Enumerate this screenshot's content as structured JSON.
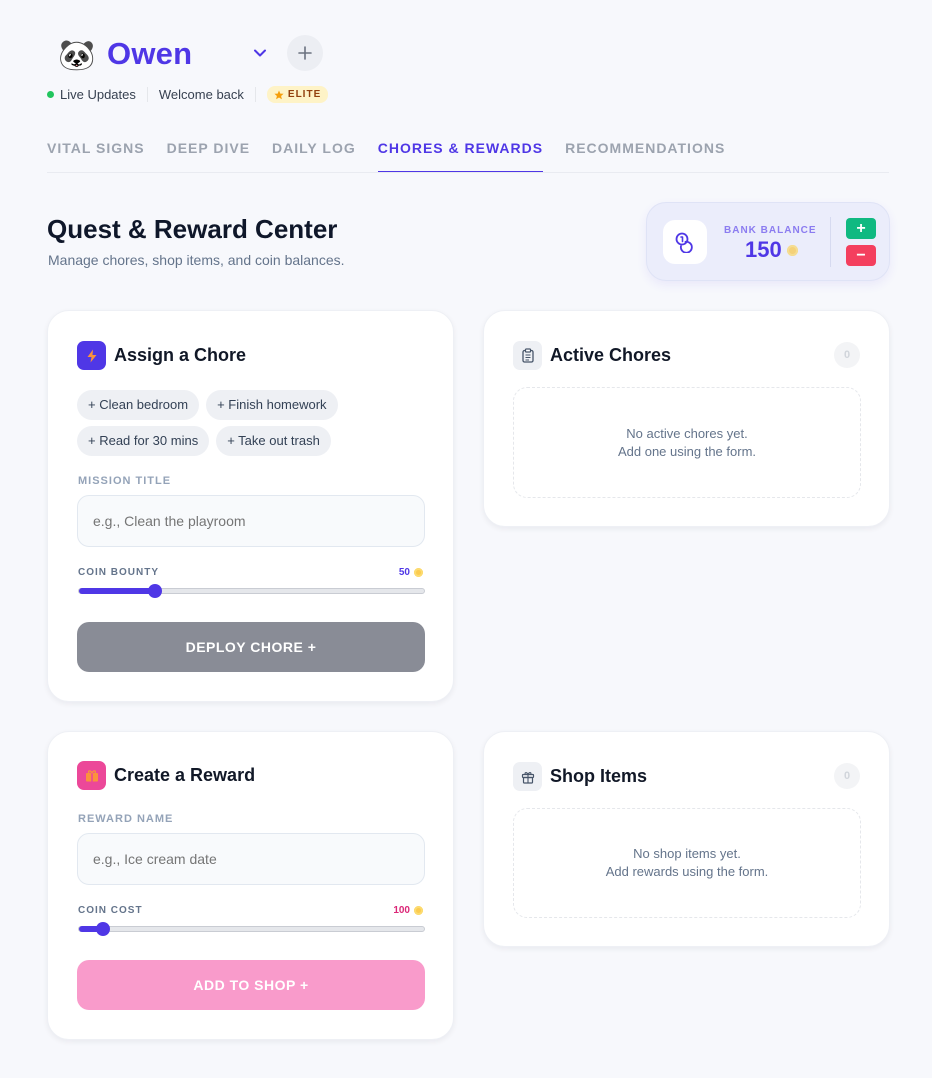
{
  "profile": {
    "avatar": "🐼",
    "name": "Owen",
    "live_label": "Live Updates",
    "welcome": "Welcome back",
    "badge": "ELITE"
  },
  "tabs": [
    {
      "label": "VITAL SIGNS",
      "active": false
    },
    {
      "label": "DEEP DIVE",
      "active": false
    },
    {
      "label": "DAILY LOG",
      "active": false
    },
    {
      "label": "CHORES & REWARDS",
      "active": true
    },
    {
      "label": "RECOMMENDATIONS",
      "active": false
    }
  ],
  "page": {
    "title": "Quest & Reward Center",
    "subtitle": "Manage chores, shop items, and coin balances."
  },
  "bank": {
    "label": "BANK BALANCE",
    "value": "150",
    "add_label": "+",
    "subtract_label": "−"
  },
  "assign_chore": {
    "title": "Assign a Chore",
    "quick_chips": [
      "+ Clean bedroom",
      "+ Finish homework",
      "+ Read for 30 mins",
      "+ Take out trash"
    ],
    "field_label": "MISSION TITLE",
    "field_placeholder": "e.g., Clean the playroom",
    "field_value": "",
    "slider_label": "COIN BOUNTY",
    "slider_value": "50",
    "slider_fraction": 0.22,
    "button_label": "DEPLOY CHORE +"
  },
  "active_chores": {
    "title": "Active Chores",
    "count": "0",
    "empty_line1": "No active chores yet.",
    "empty_line2": "Add one using the form."
  },
  "create_reward": {
    "title": "Create a Reward",
    "field_label": "REWARD NAME",
    "field_placeholder": "e.g., Ice cream date",
    "field_value": "",
    "slider_label": "COIN COST",
    "slider_value": "100",
    "slider_fraction": 0.07,
    "button_label": "ADD TO SHOP +"
  },
  "shop_items": {
    "title": "Shop Items",
    "count": "0",
    "empty_line1": "No shop items yet.",
    "empty_line2": "Add rewards using the form."
  },
  "colors": {
    "brand": "#4f37e6",
    "chore_icon": "#4f37e6",
    "reward_icon": "#ec4899",
    "deploy_button_disabled": "#898c96",
    "shop_button_disabled": "#f99bcb",
    "reward_value": "#db2777",
    "positive": "#10b981",
    "negative": "#f43f5e"
  },
  "icons": {
    "profile_menu": "chevron-down-icon",
    "add_profile": "plus-icon",
    "bank": "coins-icon",
    "chore": "bolt-icon",
    "active_chores": "clipboard-icon",
    "reward": "gift-icon",
    "shop": "gift-outline-icon"
  }
}
